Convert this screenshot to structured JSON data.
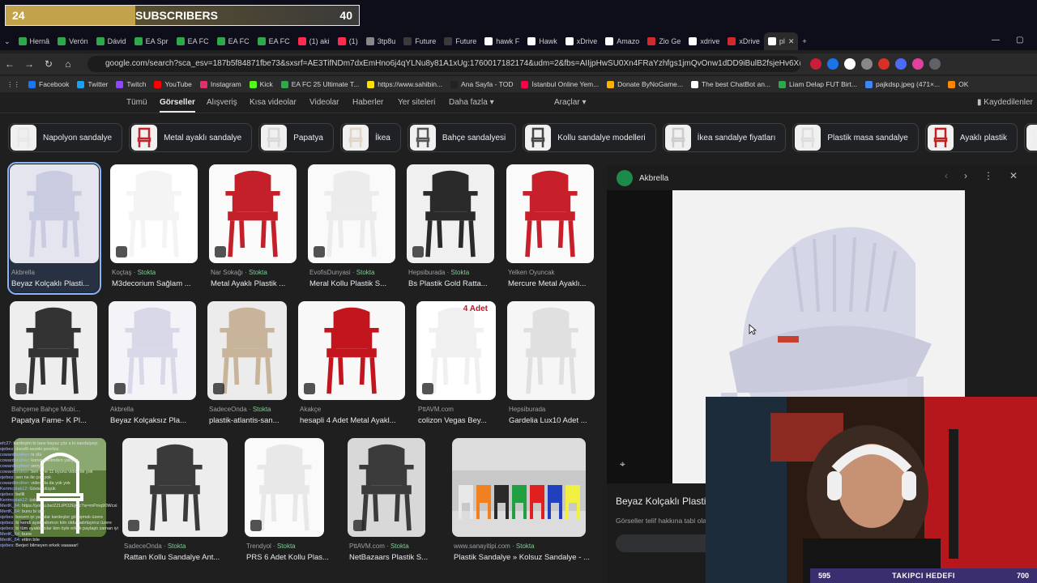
{
  "overlay": {
    "subscribers_left": "24",
    "subscribers_label": "SUBSCRIBERS",
    "subscribers_right": "40",
    "follow_left": "595",
    "follow_label": "TAKIPCI HEDEFI",
    "follow_right": "700"
  },
  "tabs": [
    {
      "label": "Hernâ",
      "color": "#2ea84a"
    },
    {
      "label": "Verón",
      "color": "#2ea84a"
    },
    {
      "label": "Dávid",
      "color": "#2ea84a"
    },
    {
      "label": "EA Spr",
      "color": "#2ea84a"
    },
    {
      "label": "EA FC",
      "color": "#2ea84a"
    },
    {
      "label": "EA FC",
      "color": "#2ea84a"
    },
    {
      "label": "EA FC",
      "color": "#2ea84a"
    },
    {
      "label": "(1) aki",
      "color": "#ff2a4f"
    },
    {
      "label": "(1)",
      "color": "#ff2a4f"
    },
    {
      "label": "3tp8u",
      "color": "#888888"
    },
    {
      "label": "Future",
      "color": "#3a3a3a"
    },
    {
      "label": "Future",
      "color": "#3a3a3a"
    },
    {
      "label": "hawk F",
      "color": "#ffffff"
    },
    {
      "label": "Hawk",
      "color": "#ffffff"
    },
    {
      "label": "xDrive",
      "color": "#ffffff"
    },
    {
      "label": "Amazo",
      "color": "#ffffff"
    },
    {
      "label": "Zio Ge",
      "color": "#d12a2a"
    },
    {
      "label": "xdrive",
      "color": "#ffffff"
    },
    {
      "label": "xDrive",
      "color": "#d12a2a"
    },
    {
      "label": "pl",
      "color": "#ffffff"
    }
  ],
  "address": {
    "url": "google.com/search?sca_esv=187b5f84871fbe73&sxsrf=AE3TifNDm7dxEmHno6j4qYLNu8y81A1xUg:1760017182174&udm=2&fbs=AIIjpHwSU0Xn4FRaYzhfgs1jmQvOnw1dDD9iBulB2fsjeHv6XuKgD..."
  },
  "bookmarks": [
    {
      "label": "Facebook",
      "color": "#1877f2"
    },
    {
      "label": "Twitter",
      "color": "#1da1f2"
    },
    {
      "label": "Twitch",
      "color": "#9146ff"
    },
    {
      "label": "YouTube",
      "color": "#ff0000"
    },
    {
      "label": "Instagram",
      "color": "#e1306c"
    },
    {
      "label": "Kick",
      "color": "#53fc18"
    },
    {
      "label": "EA FC 25 Ultimate T...",
      "color": "#2ea84a"
    },
    {
      "label": "https://www.sahibin...",
      "color": "#ffe000"
    },
    {
      "label": "Ana Sayfa - TOD",
      "color": "#222222"
    },
    {
      "label": "İstanbul Online Yem...",
      "color": "#ff0044"
    },
    {
      "label": "Donate ByNoGame...",
      "color": "#ffb300"
    },
    {
      "label": "The best ChatBot an...",
      "color": "#ffffff"
    },
    {
      "label": "Liam Delap FUT Birt...",
      "color": "#2ea84a"
    },
    {
      "label": "pajkdsp.jpeg (471×...",
      "color": "#4285f4"
    },
    {
      "label": "OK",
      "color": "#ff8800"
    }
  ],
  "gnav": {
    "items": [
      "Tümü",
      "Görseller",
      "Alışveriş",
      "Kısa videolar",
      "Videolar",
      "Haberler",
      "Yer siteleri",
      "Daha fazla ▾",
      "Araçlar ▾"
    ],
    "saved": "Kaydedilenler"
  },
  "chips": [
    "Napolyon sandalye",
    "Metal ayaklı sandalye",
    "Papatya",
    "İkea",
    "Bahçe sandalyesi",
    "Kollu sandalye modelleri",
    "İkea sandalye fiyatları",
    "Plastik masa sandalye",
    "Ayaklı plastik",
    "Kolsuz sa"
  ],
  "results": [
    {
      "source": "Akbrella",
      "stock": "",
      "title": "Beyaz Kolçaklı Plasti..."
    },
    {
      "source": "Koçtaş",
      "stock": "Stokta",
      "title": "M3decorium Sağlam ..."
    },
    {
      "source": "Nar Sokağı",
      "stock": "Stokta",
      "title": "Metal Ayaklı Plastik ..."
    },
    {
      "source": "EvofisDunyasi",
      "stock": "Stokta",
      "title": "Meral Kollu Plastik S..."
    },
    {
      "source": "Hepsiburada",
      "stock": "Stokta",
      "title": "Bs Plastik Gold Ratta..."
    },
    {
      "source": "Yelken Oyuncak",
      "stock": "",
      "title": "Mercure Metal Ayaklı..."
    },
    {
      "source": "Bahçeme Bahçe Mobi...",
      "stock": "",
      "title": "Papatya Fame- K Pl..."
    },
    {
      "source": "Akbrella",
      "stock": "",
      "title": "Beyaz Kolçaksız Pla..."
    },
    {
      "source": "SadeceOnda",
      "stock": "Stokta",
      "title": "plastik-atlantis-san..."
    },
    {
      "source": "Akakçe",
      "stock": "",
      "title": "hesapli 4 Adet Metal Ayakl..."
    },
    {
      "source": "PttAVM.com",
      "stock": "",
      "title": "colizon Vegas Bey..."
    },
    {
      "source": "Hepsiburada",
      "stock": "",
      "title": "Gardelia Lux10 Adet ..."
    },
    {
      "source": "",
      "stock": "",
      "title": ""
    },
    {
      "source": "SadeceOnda",
      "stock": "Stokta",
      "title": "Rattan Kollu Sandalye Ant..."
    },
    {
      "source": "Trendyol",
      "stock": "Stokta",
      "title": "PRS 6 Adet Kollu Plas..."
    },
    {
      "source": "PttAVM.com",
      "stock": "Stokta",
      "title": "NetBazaars Plastik S..."
    },
    {
      "source": "www.sanayitipi.com",
      "stock": "Stokta",
      "title": "Plastik Sandalye » Kolsuz Sandalye - ..."
    }
  ],
  "badge_4adet": "4 Adet",
  "panel": {
    "source": "Akbrella",
    "title": "Beyaz Kolçaklı Plasti",
    "copyright": "Görseller telif hakkına tabi olab"
  },
  "chat": [
    {
      "user": "efc27",
      "msg": "kardeşim bi tane beyaz çöz s ki sandalyeyi"
    },
    {
      "user": "ojebes",
      "msg": "docelli sezeki şerefsiz"
    },
    {
      "user": "cowardbrother",
      "msg": "İz ölü"
    },
    {
      "user": "cowardbrother",
      "msg": "konsiye elimden yatıyoz"
    },
    {
      "user": "cowardbrother",
      "msg": "seriyet"
    },
    {
      "user": "cowardbrother",
      "msg": "ben yine 11 oyunu video ile yok"
    },
    {
      "user": "ojebes",
      "msg": "sen ne ile çok yok"
    },
    {
      "user": "cowardbrother",
      "msg": "video da da yok yok"
    },
    {
      "user": "Kerimcolak12",
      "msg": "Görsel düşük"
    },
    {
      "user": "ojebes",
      "msg": "bellli"
    },
    {
      "user": "Kerimcolak12",
      "msg": "üsk"
    },
    {
      "user": "MertK_64",
      "msg": "https://youtu.be/ZZLtPO2EjOc?si=mPmq90Wcxi"
    },
    {
      "user": "MertK_64",
      "msg": "bunu bi izle"
    },
    {
      "user": "ojebes",
      "msg": "bocem iyi yapalar kardeşler görüşmek üzere"
    },
    {
      "user": "ojebes",
      "msg": "bi kendi ayakkabımızı kim oldu hatırlayınız üzere"
    },
    {
      "user": "ojebes",
      "msg": "bi tüm ayakkabılar kim öyle erkek paylaştı zaman iyi"
    },
    {
      "user": "MertK_64",
      "msg": "bune"
    },
    {
      "user": "MertK_64",
      "msg": "ettim bile"
    },
    {
      "user": "ojebes",
      "msg": "Berjeri bilmeyen erkek vaaaaar!"
    }
  ],
  "colors": {
    "selected_outline": "#8ab4f8",
    "stock_green": "#81c995",
    "page_bg": "#1f1f1f"
  }
}
